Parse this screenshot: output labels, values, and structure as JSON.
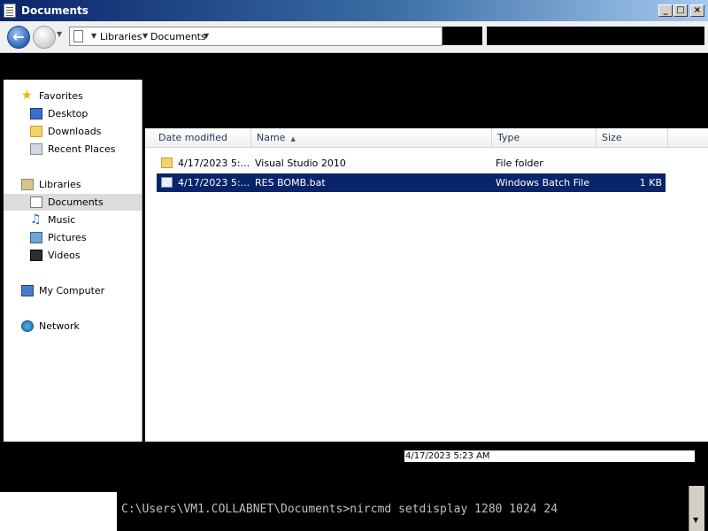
{
  "window": {
    "title": "Documents"
  },
  "titlebar_buttons": {
    "minimize": "_",
    "maximize": "□",
    "close": "×"
  },
  "address": {
    "crumbs": [
      "Libraries",
      "Documents"
    ]
  },
  "nav": {
    "favorites_label": "Favorites",
    "favorites": [
      "Desktop",
      "Downloads",
      "Recent Places"
    ],
    "libraries_label": "Libraries",
    "libraries": [
      "Documents",
      "Music",
      "Pictures",
      "Videos"
    ],
    "computer_label": "My Computer",
    "network_label": "Network",
    "selected": "Documents"
  },
  "columns": [
    "Date modified",
    "Name",
    "Type",
    "Size"
  ],
  "files": [
    {
      "date": "4/17/2023 5:...",
      "name": "Visual Studio 2010",
      "type": "File folder",
      "size": "",
      "icon": "folder-icon"
    },
    {
      "date": "4/17/2023 5:...",
      "name": "RES BOMB.bat",
      "type": "Windows Batch File",
      "size": "1 KB",
      "icon": "batch-file-icon",
      "selected": true
    }
  ],
  "status": {
    "date_modified": "4/17/2023 5:23 AM"
  },
  "console": {
    "command_line": "C:\\Users\\VM1.COLLABNET\\Documents>nircmd setdisplay 1280 1024 24"
  },
  "colors": {
    "selection": "#0a246a",
    "title_gradient_start": "#0a246a"
  }
}
